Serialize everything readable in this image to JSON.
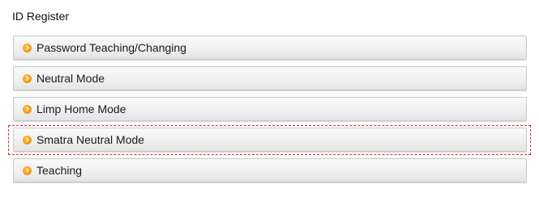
{
  "page": {
    "title": "ID Register"
  },
  "menu": {
    "items": [
      {
        "label": "Password Teaching/Changing",
        "icon": "arrow-bullet-icon"
      },
      {
        "label": "Neutral Mode",
        "icon": "arrow-bullet-icon"
      },
      {
        "label": "Limp Home Mode",
        "icon": "arrow-bullet-icon"
      },
      {
        "label": "Smatra Neutral Mode",
        "icon": "arrow-bullet-icon",
        "highlighted": true
      },
      {
        "label": "Teaching",
        "icon": "arrow-bullet-icon"
      }
    ]
  },
  "colors": {
    "bullet": "#f29a12",
    "highlight_border": "#e0202a",
    "button_border": "#c9c9c9"
  }
}
